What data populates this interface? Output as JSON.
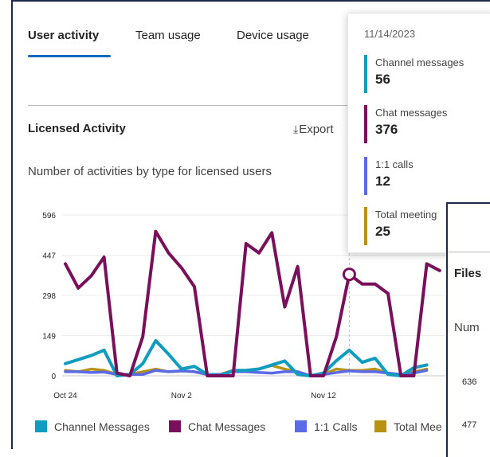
{
  "tabs": [
    {
      "label": "User activity",
      "active": true
    },
    {
      "label": "Team usage",
      "active": false
    },
    {
      "label": "Device usage",
      "active": false
    }
  ],
  "section": {
    "title": "Licensed Activity",
    "export_label": "Export",
    "subtitle": "Number of activities by type for licensed users"
  },
  "chart_data": {
    "type": "line",
    "y_ticks": [
      "596",
      "447",
      "298",
      "149",
      "0"
    ],
    "x_ticks": [
      "Oct 24",
      "Nov 2",
      "Nov 12"
    ],
    "ylim": [
      0,
      596
    ],
    "series": [
      {
        "name": "Channel Messages",
        "color": "#0f9cbf",
        "values": [
          45,
          60,
          75,
          95,
          0,
          5,
          45,
          130,
          80,
          25,
          35,
          5,
          0,
          20,
          20,
          25,
          40,
          55,
          5,
          0,
          10,
          56,
          95,
          50,
          65,
          5,
          0,
          30,
          40
        ]
      },
      {
        "name": "Chat Messages",
        "color": "#7a0f5b",
        "values": [
          415,
          325,
          370,
          440,
          10,
          0,
          145,
          535,
          455,
          400,
          330,
          0,
          0,
          0,
          490,
          455,
          530,
          255,
          405,
          0,
          0,
          145,
          376,
          340,
          340,
          305,
          0,
          0,
          415,
          390
        ]
      },
      {
        "name": "1:1 Calls",
        "color": "#5b6be8",
        "values": [
          15,
          15,
          12,
          14,
          5,
          5,
          5,
          20,
          15,
          18,
          15,
          5,
          5,
          15,
          15,
          12,
          10,
          15,
          15,
          0,
          5,
          12,
          18,
          15,
          15,
          10,
          5,
          10,
          20
        ]
      },
      {
        "name": "Total Meetings",
        "color": "#b89212",
        "values": [
          20,
          15,
          25,
          20,
          5,
          5,
          15,
          25,
          15,
          18,
          15,
          5,
          5,
          20,
          20,
          25,
          38,
          25,
          15,
          0,
          5,
          25,
          20,
          20,
          25,
          10,
          5,
          15,
          25
        ]
      }
    ]
  },
  "tooltip": {
    "date": "11/14/2023",
    "items": [
      {
        "label": "Channel messages",
        "value": "56",
        "color": "#0f9cbf"
      },
      {
        "label": "Chat messages",
        "value": "376",
        "color": "#7a0f5b"
      },
      {
        "label": "1:1 calls",
        "value": "12",
        "color": "#5b6be8"
      },
      {
        "label": "Total meeting",
        "value": "25",
        "color": "#b89212"
      }
    ]
  },
  "legend": [
    {
      "label": "Channel Messages",
      "color": "#0f9cbf"
    },
    {
      "label": "Chat Messages",
      "color": "#7a0f5b"
    },
    {
      "label": "1:1 Calls",
      "color": "#5b6be8"
    },
    {
      "label": "Total Mee",
      "color": "#b89212"
    }
  ],
  "second_panel": {
    "title": "Files",
    "subtitle": "Num",
    "y_ticks": [
      "636",
      "477"
    ]
  }
}
